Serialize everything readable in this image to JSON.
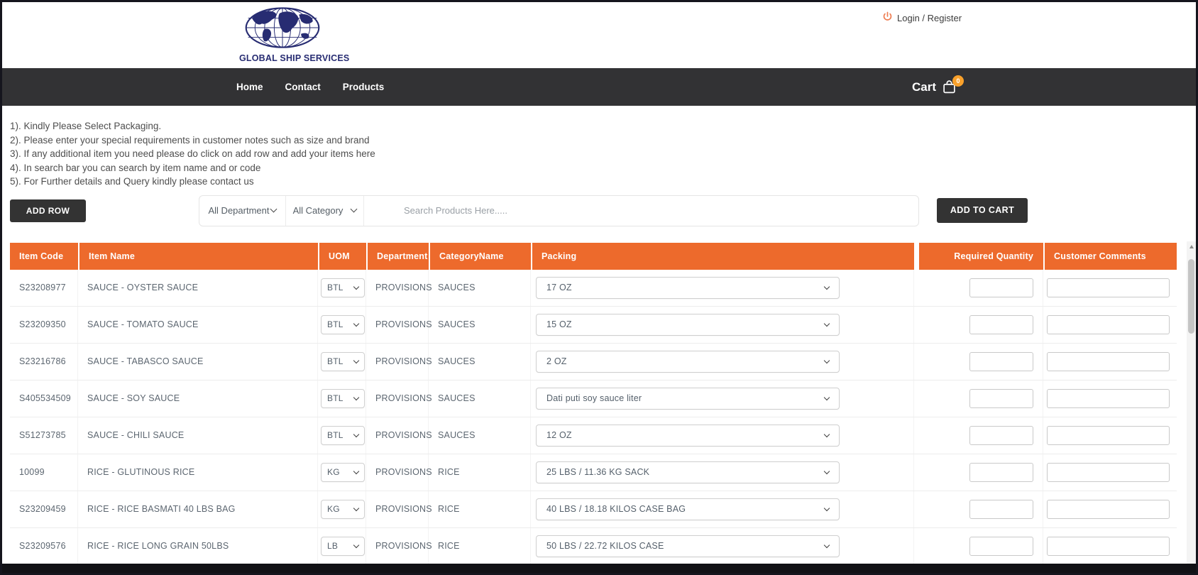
{
  "header": {
    "logo_text": "GLOBAL SHIP SERVICES",
    "login_label": "Login / Register"
  },
  "nav": {
    "items": [
      "Home",
      "Contact",
      "Products"
    ],
    "cart_label": "Cart",
    "cart_count": "0"
  },
  "instructions": [
    "1). Kindly Please Select Packaging.",
    "2). Please enter your special requirements in customer notes such as size and brand",
    "3). If any additional item you need please do click on add row and add your items here",
    "4). In search bar you can search by item name and or code",
    "5). For Further details and Query kindly please contact us"
  ],
  "toolbar": {
    "add_row_label": "ADD ROW",
    "department_filter": "All Department",
    "category_filter": "All Category",
    "search_placeholder": "Search Products Here.....",
    "add_to_cart_label": "ADD TO CART"
  },
  "table": {
    "columns": [
      "Item Code",
      "Item Name",
      "UOM",
      "Department",
      "CategoryName",
      "Packing",
      "Required Quantity",
      "Customer Comments"
    ],
    "rows": [
      {
        "item_code": "S23208977",
        "item_name": "SAUCE - OYSTER SAUCE",
        "uom": "BTL",
        "department": "PROVISIONS",
        "category": "SAUCES",
        "packing": "17 OZ",
        "required_quantity": "",
        "customer_comments": ""
      },
      {
        "item_code": "S23209350",
        "item_name": "SAUCE - TOMATO SAUCE",
        "uom": "BTL",
        "department": "PROVISIONS",
        "category": "SAUCES",
        "packing": "15 OZ",
        "required_quantity": "",
        "customer_comments": ""
      },
      {
        "item_code": "S23216786",
        "item_name": "SAUCE - TABASCO SAUCE",
        "uom": "BTL",
        "department": "PROVISIONS",
        "category": "SAUCES",
        "packing": "2 OZ",
        "required_quantity": "",
        "customer_comments": ""
      },
      {
        "item_code": "S405534509",
        "item_name": "SAUCE - SOY SAUCE",
        "uom": "BTL",
        "department": "PROVISIONS",
        "category": "SAUCES",
        "packing": "Dati puti soy sauce liter",
        "required_quantity": "",
        "customer_comments": ""
      },
      {
        "item_code": "S51273785",
        "item_name": "SAUCE - CHILI SAUCE",
        "uom": "BTL",
        "department": "PROVISIONS",
        "category": "SAUCES",
        "packing": "12 OZ",
        "required_quantity": "",
        "customer_comments": ""
      },
      {
        "item_code": "10099",
        "item_name": "RICE - GLUTINOUS RICE",
        "uom": "KG",
        "department": "PROVISIONS",
        "category": "RICE",
        "packing": "25 LBS / 11.36 KG SACK",
        "required_quantity": "",
        "customer_comments": ""
      },
      {
        "item_code": "S23209459",
        "item_name": "RICE - RICE BASMATI 40 LBS BAG",
        "uom": "KG",
        "department": "PROVISIONS",
        "category": "RICE",
        "packing": "40 LBS / 18.18 KILOS CASE BAG",
        "required_quantity": "",
        "customer_comments": ""
      },
      {
        "item_code": "S23209576",
        "item_name": "RICE - RICE LONG GRAIN 50LBS",
        "uom": "LB",
        "department": "PROVISIONS",
        "category": "RICE",
        "packing": "50 LBS / 22.72 KILOS CASE",
        "required_quantity": "",
        "customer_comments": ""
      }
    ]
  },
  "colors": {
    "accent_orange": "#ED6A2C",
    "dark_bar": "#323234",
    "badge_orange": "#F9A12B",
    "logo_navy": "#272C72"
  }
}
